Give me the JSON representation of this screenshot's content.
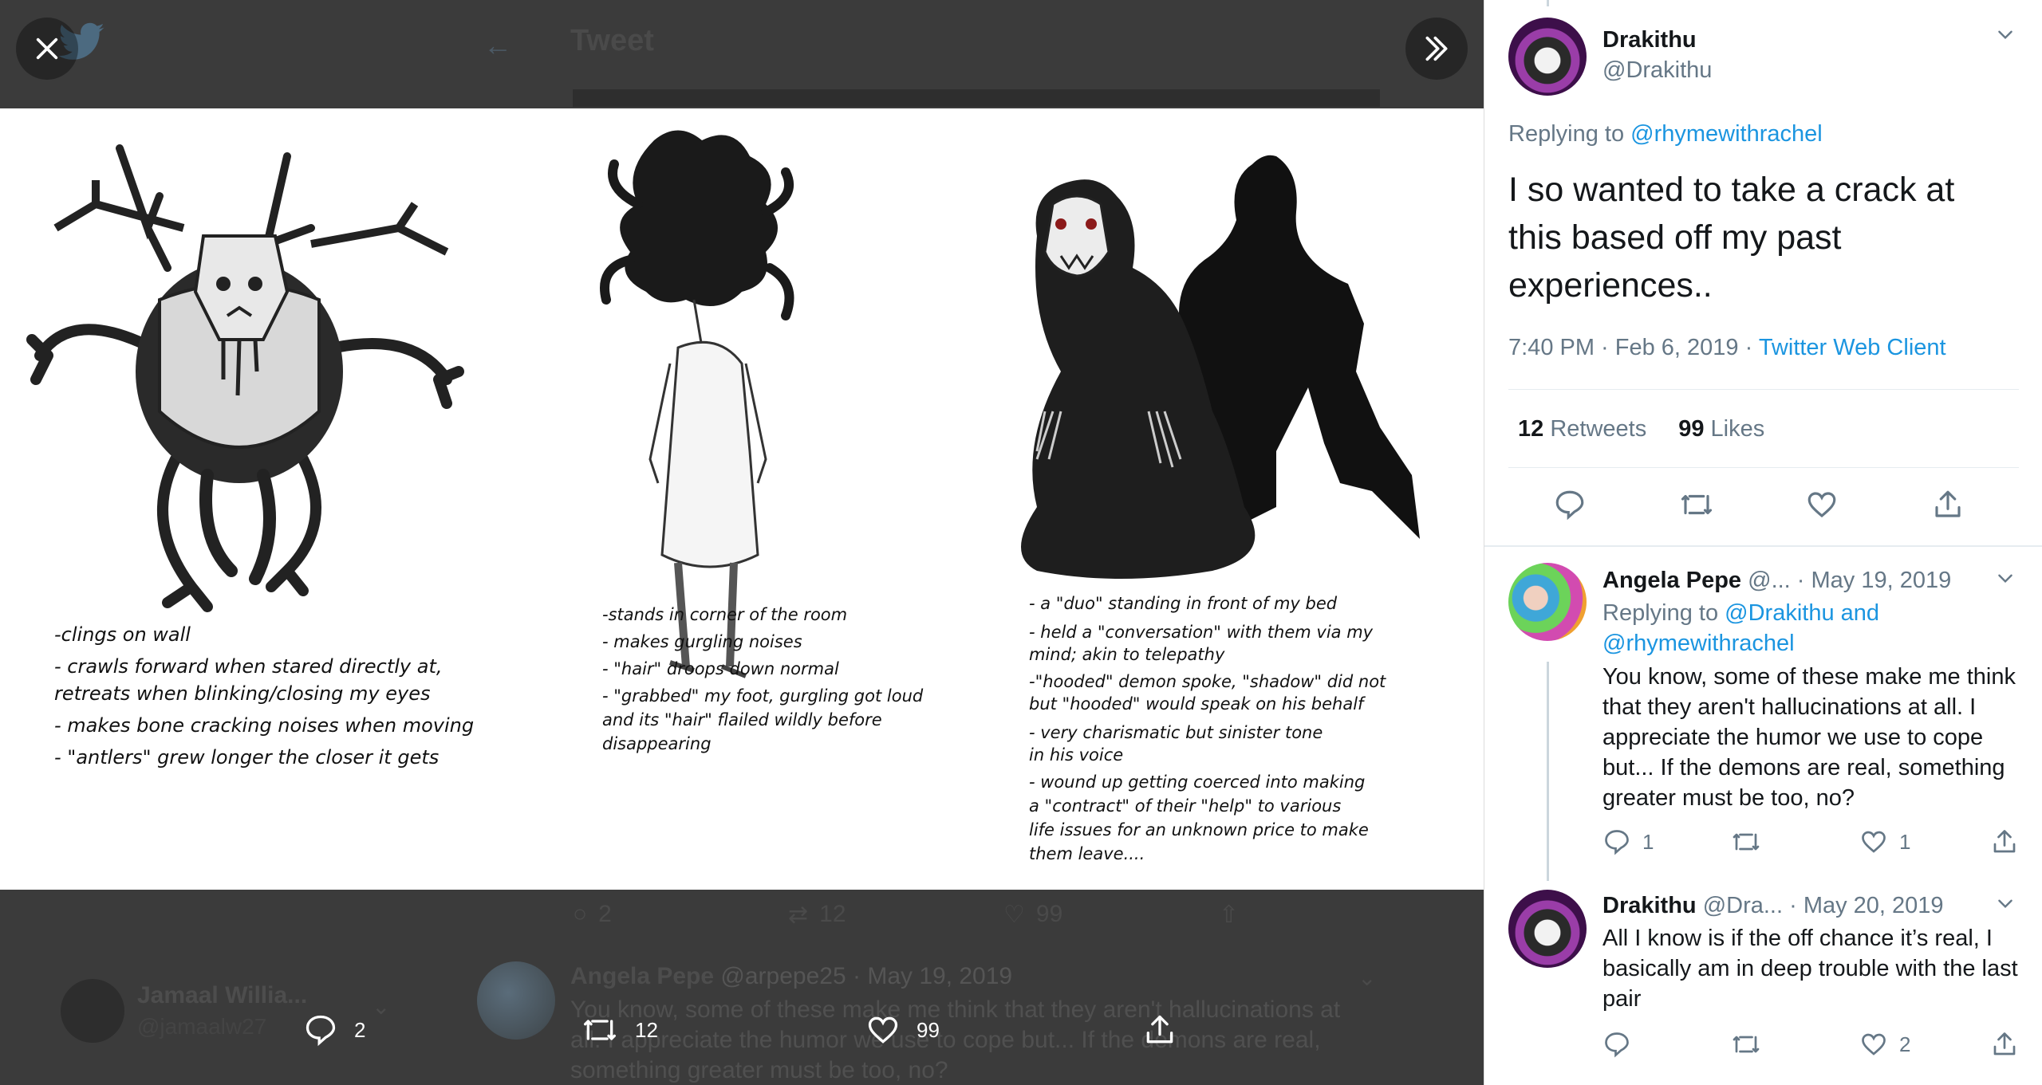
{
  "background": {
    "title": "Tweet",
    "below_actions": {
      "reply_count": "2",
      "retweet_count": "12",
      "like_count": "99"
    },
    "row1": {
      "name": "Jamaal Willia...",
      "handle": "@jamaalw27"
    },
    "row2": {
      "name": "Angela Pepe",
      "handle": "@arpepe25",
      "date": "· May 19, 2019",
      "text": "You know, some of these make me think that they aren't hallucinations at all. I appreciate the humor we use to cope but... If the demons are real, something greater must be too, no?"
    }
  },
  "viewer": {
    "reply_count": "2",
    "retweet_count": "12",
    "like_count": "99",
    "drawing_notes": {
      "col1": [
        "-clings on wall",
        "- crawls forward when stared directly at,",
        "  retreats when blinking/closing my eyes",
        "- makes bone cracking noises when moving",
        "- \"antlers\" grew longer the closer it gets"
      ],
      "col2": [
        "-stands in corner of the room",
        "- makes gurgling noises",
        "- \"hair\" droops down normal",
        "- \"grabbed\" my foot, gurgling got loud",
        "  and its \"hair\" flailed wildly before",
        "  disappearing"
      ],
      "col3": [
        "- a \"duo\" standing in front of my bed",
        "- held a \"conversation\" with them via my",
        "  mind; akin to telepathy",
        "-\"hooded\" demon spoke, \"shadow\" did not",
        "  but \"hooded\" would speak on his behalf",
        "- very charismatic but sinister tone",
        "  in his voice",
        "- wound up getting coerced into making",
        "  a \"contract\" of their \"help\" to various",
        "  life issues for an unknown price to make",
        "  them leave...."
      ]
    }
  },
  "tweet": {
    "name": "Drakithu",
    "handle": "@Drakithu",
    "replying_prefix": "Replying to",
    "replying_to": "@rhymewithrachel",
    "text": "I so wanted to take a crack at this based off my past experiences..",
    "time": "7:40 PM · Feb 6, 2019 · ",
    "client": "Twitter Web Client",
    "retweets_count": "12",
    "retweets_label": "Retweets",
    "likes_count": "99",
    "likes_label": "Likes"
  },
  "replies": [
    {
      "name": "Angela Pepe",
      "handle_date": "@... · May 19, 2019",
      "replying_prefix": "Replying to",
      "replying_to_1": "@Drakithu",
      "and": "and",
      "replying_to_2": "@rhymewithrachel",
      "text": "You know, some of these make me think that they aren't hallucinations at all. I appreciate the humor we use to cope but... If the demons are real, something greater must be too, no?",
      "reply_count": "1",
      "retweet_count": "",
      "like_count": "1"
    },
    {
      "name": "Drakithu",
      "handle_date": "@Dra... · May 20, 2019",
      "text": "All I know is if the off chance it’s real, I basically am in deep trouble with the last pair",
      "reply_count": "",
      "retweet_count": "",
      "like_count": "2"
    }
  ],
  "colors": {
    "link": "#1b95e0",
    "muted": "#657786",
    "text": "#14171a"
  }
}
